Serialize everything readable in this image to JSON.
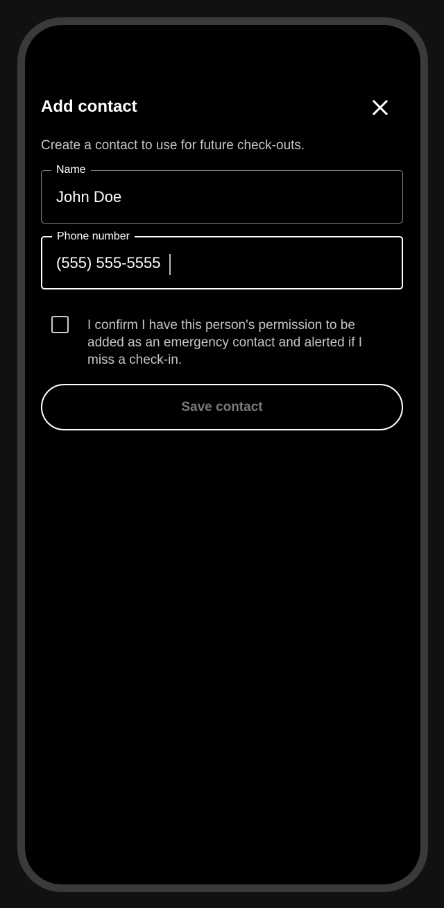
{
  "dialog": {
    "title": "Add contact",
    "close_icon": "close-icon",
    "subtitle": "Create a contact to use for future check-outs."
  },
  "form": {
    "name": {
      "label": "Name",
      "value": "John Doe"
    },
    "phone": {
      "label": "Phone number",
      "value": "(555) 555-5555"
    },
    "consent": {
      "checked": false,
      "text": "I confirm I have this person's permission to be added as an emergency contact and alerted if I miss a check-in."
    },
    "save_label": "Save contact"
  },
  "colors": {
    "background": "#000000",
    "frame": "#3a3a3a",
    "text_primary": "#ffffff",
    "text_secondary": "#c6c6c6",
    "button_disabled_text": "#7a7a7a"
  }
}
